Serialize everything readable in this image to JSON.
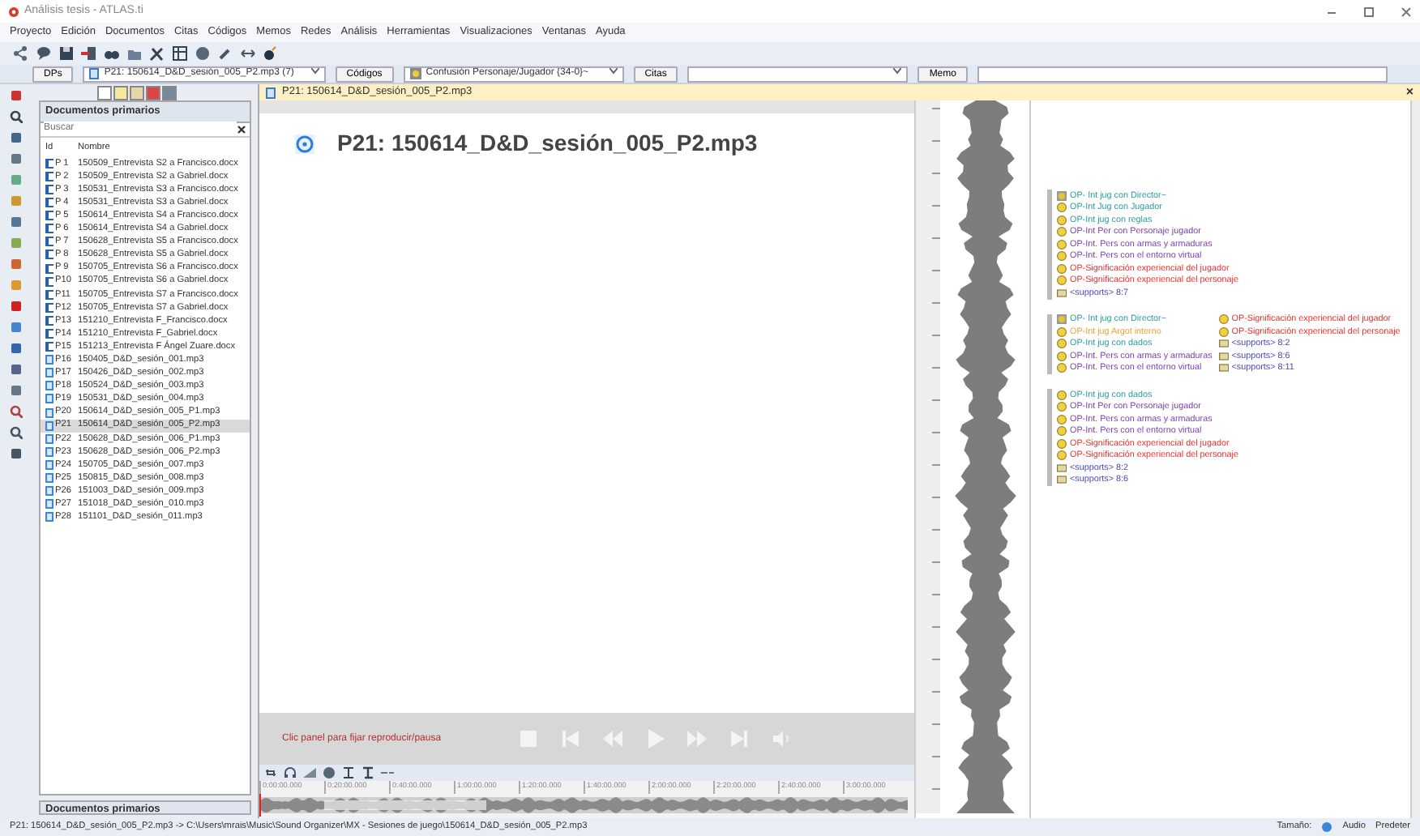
{
  "window": {
    "title": "Análisis tesis - ATLAS.ti"
  },
  "menu": [
    "Proyecto",
    "Edición",
    "Documentos",
    "Citas",
    "Códigos",
    "Memos",
    "Redes",
    "Análisis",
    "Herramientas",
    "Visualizaciones",
    "Ventanas",
    "Ayuda"
  ],
  "selectors": [
    {
      "button": "DPs",
      "value": "P21: 150614_D&D_sesión_005_P2.mp3 (7)",
      "kind": "doc"
    },
    {
      "button": "Códigos",
      "value": "Confusión Personaje/Jugador {34-0}~",
      "kind": "code"
    },
    {
      "button": "Citas",
      "kind": "plain"
    },
    {
      "button": "Memo",
      "kind": "field"
    }
  ],
  "doc_manager": {
    "title": "Documentos primarios",
    "search": {
      "placeholder": "Buscar"
    },
    "columns": [
      "Id",
      "Nombre"
    ],
    "footer": "Documentos primarios",
    "rows": [
      {
        "id": "P 1",
        "name": "150509_Entrevista S2 a Francisco.docx",
        "kind": "docx",
        "selected": false
      },
      {
        "id": "P 2",
        "name": "150509_Entrevista S2 a Gabriel.docx",
        "kind": "docx",
        "selected": false
      },
      {
        "id": "P 3",
        "name": "150531_Entrevista S3 a Francisco.docx",
        "kind": "docx",
        "selected": false
      },
      {
        "id": "P 4",
        "name": "150531_Entrevista S3 a Gabriel.docx",
        "kind": "docx",
        "selected": false
      },
      {
        "id": "P 5",
        "name": "150614_Entrevista S4 a Francisco.docx",
        "kind": "docx",
        "selected": false
      },
      {
        "id": "P 6",
        "name": "150614_Entrevista S4 a Gabriel.docx",
        "kind": "docx",
        "selected": false
      },
      {
        "id": "P 7",
        "name": "150628_Entrevista S5 a Francisco.docx",
        "kind": "docx",
        "selected": false
      },
      {
        "id": "P 8",
        "name": "150628_Entrevista S5 a Gabriel.docx",
        "kind": "docx",
        "selected": false
      },
      {
        "id": "P 9",
        "name": "150705_Entrevista S6 a Francisco.docx",
        "kind": "docx",
        "selected": false
      },
      {
        "id": "P10",
        "name": "150705_Entrevista S6 a Gabriel.docx",
        "kind": "docx",
        "selected": false
      },
      {
        "id": "P11",
        "name": "150705_Entrevista S7 a Francisco.docx",
        "kind": "docx",
        "selected": false
      },
      {
        "id": "P12",
        "name": "150705_Entrevista S7 a Gabriel.docx",
        "kind": "docx",
        "selected": false
      },
      {
        "id": "P13",
        "name": "151210_Entrevista F_Francisco.docx",
        "kind": "docx",
        "selected": false
      },
      {
        "id": "P14",
        "name": "151210_Entrevista F_Gabriel.docx",
        "kind": "docx",
        "selected": false
      },
      {
        "id": "P15",
        "name": "151213_Entrevista F Ángel Zuare.docx",
        "kind": "docx",
        "selected": false
      },
      {
        "id": "P16",
        "name": "150405_D&D_sesión_001.mp3",
        "kind": "mp3",
        "selected": false
      },
      {
        "id": "P17",
        "name": "150426_D&D_sesión_002.mp3",
        "kind": "mp3",
        "selected": false
      },
      {
        "id": "P18",
        "name": "150524_D&D_sesión_003.mp3",
        "kind": "mp3",
        "selected": false
      },
      {
        "id": "P19",
        "name": "150531_D&D_sesión_004.mp3",
        "kind": "mp3",
        "selected": false
      },
      {
        "id": "P20",
        "name": "150614_D&D_sesión_005_P1.mp3",
        "kind": "mp3",
        "selected": false
      },
      {
        "id": "P21",
        "name": "150614_D&D_sesión_005_P2.mp3",
        "kind": "mp3",
        "selected": true
      },
      {
        "id": "P22",
        "name": "150628_D&D_sesión_006_P1.mp3",
        "kind": "mp3",
        "selected": false
      },
      {
        "id": "P23",
        "name": "150628_D&D_sesión_006_P2.mp3",
        "kind": "mp3",
        "selected": false
      },
      {
        "id": "P24",
        "name": "150705_D&D_sesión_007.mp3",
        "kind": "mp3",
        "selected": false
      },
      {
        "id": "P25",
        "name": "150815_D&D_sesión_008.mp3",
        "kind": "mp3",
        "selected": false
      },
      {
        "id": "P26",
        "name": "151003_D&D_sesión_009.mp3",
        "kind": "mp3",
        "selected": false
      },
      {
        "id": "P27",
        "name": "151018_D&D_sesión_010.mp3",
        "kind": "mp3",
        "selected": false
      },
      {
        "id": "P28",
        "name": "151101_D&D_sesión_011.mp3",
        "kind": "mp3",
        "selected": false
      }
    ]
  },
  "document": {
    "tab": "P21: 150614_D&D_sesión_005_P2.mp3",
    "close": "×",
    "title": "P21: 150614_D&D_sesión_005_P2.mp3",
    "player": {
      "hint": "Clic panel para fijar reproducir/pausa"
    },
    "timeline": [
      "0:00:00.000",
      "0:20:00.000",
      "0:40:00.000",
      "1:00:00.000",
      "1:20:00.000",
      "1:40:00.000",
      "2:00:00.000",
      "2:20:00.000",
      "2:40:00.000",
      "3:00:00.000"
    ]
  },
  "margin": [
    {
      "columns": [
        [
          {
            "label": "OP- Int jug con Director~",
            "kind": "hub",
            "color": "#2a9d9d"
          },
          {
            "label": "OP-Int Jug con Jugador",
            "kind": "code",
            "color": "#2a9d9d"
          },
          {
            "label": "OP-Int jug con reglas",
            "kind": "code",
            "color": "#2a9d9d"
          },
          {
            "label": "OP-Int Per con Personaje jugador",
            "kind": "code",
            "color": "#7b3fb0"
          },
          {
            "label": "OP-Int. Pers con armas y armaduras",
            "kind": "code",
            "color": "#7b3fb0"
          },
          {
            "label": "OP-Int. Pers con el entorno virtual",
            "kind": "code",
            "color": "#7b3fb0"
          },
          {
            "label": "OP-Significación experiencial del jugador",
            "kind": "code",
            "color": "#e8322e"
          },
          {
            "label": "OP-Significación experiencial del personaje",
            "kind": "code",
            "color": "#e8322e"
          },
          {
            "label": "<supports> 8:7",
            "kind": "memo",
            "color": "#4a48b8"
          }
        ]
      ]
    },
    {
      "columns": [
        [
          {
            "label": "OP- Int jug con Director~",
            "kind": "hub",
            "color": "#2a9d9d"
          },
          {
            "label": "OP-Int jug Argot interno",
            "kind": "code",
            "color": "#f0a030"
          },
          {
            "label": "OP-Int jug con dados",
            "kind": "code",
            "color": "#2a9d9d"
          },
          {
            "label": "OP-Int. Pers con armas y armaduras",
            "kind": "code",
            "color": "#7b3fb0"
          },
          {
            "label": "OP-Int. Pers con el entorno virtual",
            "kind": "code",
            "color": "#7b3fb0"
          }
        ],
        [
          {
            "label": "OP-Significación experiencial del jugador",
            "kind": "code",
            "color": "#e8322e"
          },
          {
            "label": "OP-Significación experiencial del personaje",
            "kind": "code",
            "color": "#e8322e"
          },
          {
            "label": "<supports> 8:2",
            "kind": "memo",
            "color": "#4a48b8"
          },
          {
            "label": "<supports> 8:6",
            "kind": "memo",
            "color": "#4a48b8"
          },
          {
            "label": "<supports> 8:11",
            "kind": "memo",
            "color": "#4a48b8"
          }
        ]
      ]
    },
    {
      "columns": [
        [
          {
            "label": "OP-Int jug con dados",
            "kind": "code",
            "color": "#2a9d9d"
          },
          {
            "label": "OP-Int Per con Personaje jugador",
            "kind": "code",
            "color": "#7b3fb0"
          },
          {
            "label": "OP-Int. Pers con armas y armaduras",
            "kind": "code",
            "color": "#7b3fb0"
          },
          {
            "label": "OP-Int. Pers con el entorno virtual",
            "kind": "code",
            "color": "#7b3fb0"
          },
          {
            "label": "OP-Significación experiencial del jugador",
            "kind": "code",
            "color": "#e8322e"
          },
          {
            "label": "OP-Significación experiencial del personaje",
            "kind": "code",
            "color": "#e8322e"
          },
          {
            "label": "<supports> 8:2",
            "kind": "memo",
            "color": "#4a48b8"
          },
          {
            "label": "<supports> 8:6",
            "kind": "memo",
            "color": "#4a48b8"
          }
        ]
      ]
    }
  ],
  "status_bar": {
    "path": "P21: 150614_D&D_sesión_005_P2.mp3 -> C:\\Users\\mrais\\Music\\Sound Organizer\\MX - Sesiones de juego\\150614_D&D_sesión_005_P2.mp3",
    "size": "Tamaño:",
    "mode": "Audio",
    "layout": "Predeter"
  }
}
